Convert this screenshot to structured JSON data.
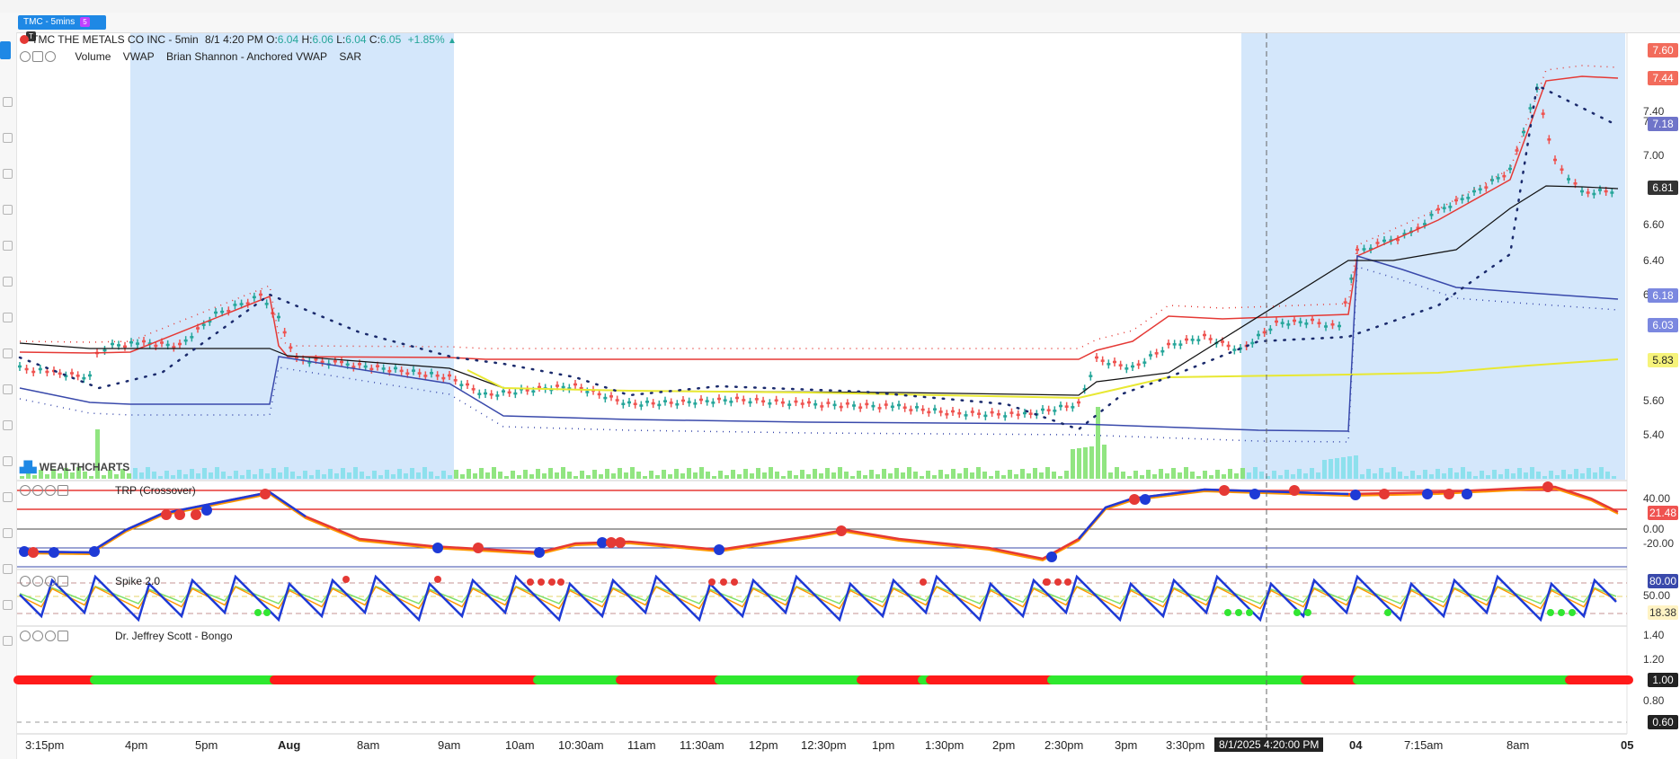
{
  "tab": {
    "label": "TMC - 5mins",
    "badge_s": "5",
    "badge_t": "T"
  },
  "header": {
    "title": "TMC THE METALS CO INC - 5min",
    "datetime": "8/1 4:20 PM",
    "ohlc": {
      "o_label": "O:",
      "o": "6.04",
      "h_label": "H:",
      "h": "6.06",
      "l_label": "L:",
      "l": "6.04",
      "c_label": "C:",
      "c": "6.05",
      "change": "+1.85%",
      "arrow": "▲"
    },
    "indicators": [
      "Volume",
      "VWAP",
      "Brian Shannon - Anchored VWAP",
      "SAR"
    ]
  },
  "watermark": "WEALTHCHARTS",
  "panes": {
    "trp": "TRP (Crossover)",
    "spike": "Spike 2.0",
    "bongo": "Dr. Jeffrey Scott - Bongo"
  },
  "price_axis": [
    "7.40",
    "7.20",
    "7.00",
    "6.60",
    "6.40",
    "6.20",
    "5.60",
    "5.40"
  ],
  "price_tags": [
    {
      "value": "7.60",
      "color": "#f26b5b"
    },
    {
      "value": "7.44",
      "color": "#f26b5b"
    },
    {
      "value": "7.18",
      "color": "#6f74c9"
    },
    {
      "value": "6.81",
      "color": "#333333"
    },
    {
      "value": "6.18",
      "color": "#7b88e0"
    },
    {
      "value": "6.03",
      "color": "#7b88e0"
    },
    {
      "value": "5.83",
      "color": "#f6f37a"
    }
  ],
  "trp_axis": [
    "40.00",
    "0.00",
    "-20.00"
  ],
  "trp_tag": "21.48",
  "spike_tags": [
    "80.00",
    "50.00",
    "18.38"
  ],
  "bongo_axis": [
    "1.40",
    "1.20",
    "0.80"
  ],
  "bongo_tags": [
    "1.00",
    "0.60"
  ],
  "x_axis": [
    "3:15pm",
    "4pm",
    "5pm",
    "Aug",
    "8am",
    "9am",
    "10am",
    "10:30am",
    "11am",
    "11:30am",
    "12pm",
    "12:30pm",
    "1pm",
    "1:30pm",
    "2pm",
    "2:30pm",
    "3pm",
    "3:30pm",
    "04",
    "7:15am",
    "8am",
    "05"
  ],
  "crosshair_time": "8/1/2025 4:20:00 PM",
  "colors": {
    "up": "#26a69a",
    "down": "#ef5350",
    "session": "#d4e7fb",
    "vwap": "#111111",
    "anchored_vwap": "#e8e832",
    "band_upper": "#e53935",
    "band_lower": "#3949ab",
    "accent": "#1e88e5"
  }
}
